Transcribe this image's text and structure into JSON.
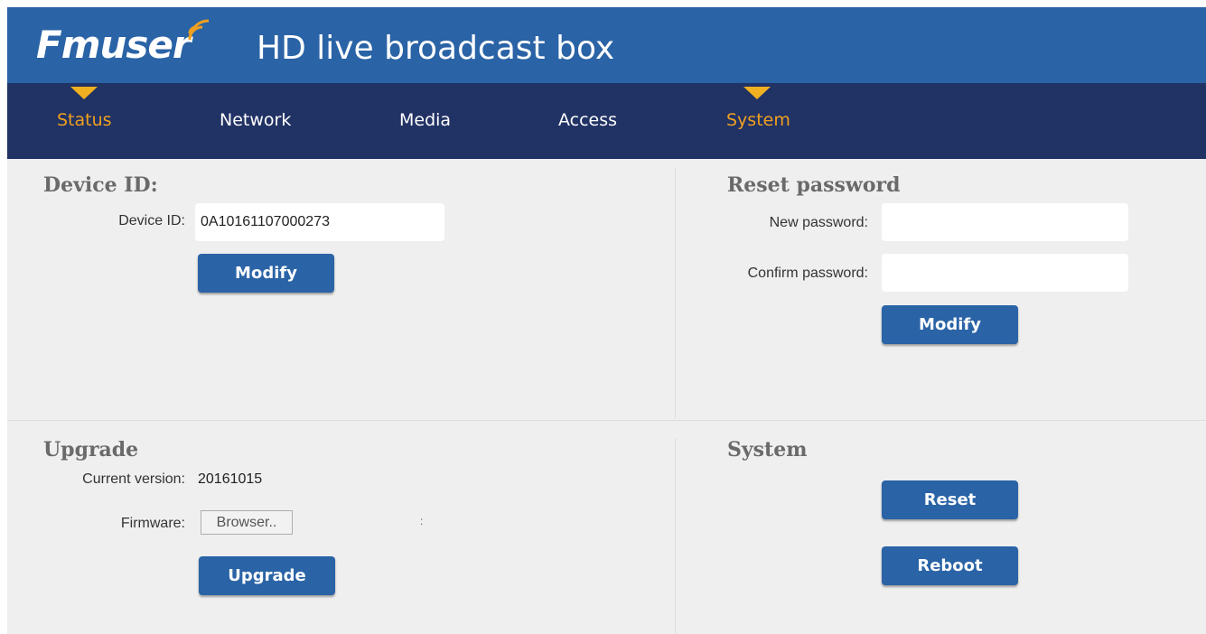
{
  "header": {
    "logo_text": "Fmuser",
    "title": "HD live broadcast box"
  },
  "nav": {
    "items": [
      {
        "label": "Status",
        "active": true
      },
      {
        "label": "Network",
        "active": false
      },
      {
        "label": "Media",
        "active": false
      },
      {
        "label": "Access",
        "active": false
      },
      {
        "label": "System",
        "active": true
      }
    ]
  },
  "device": {
    "title": "Device ID:",
    "label": "Device ID:",
    "value": "0A10161107000273",
    "button": "Modify"
  },
  "reset_password": {
    "title": "Reset password",
    "new_label": "New password:",
    "new_value": "",
    "confirm_label": "Confirm password:",
    "confirm_value": "",
    "button": "Modify"
  },
  "upgrade": {
    "title": "Upgrade",
    "version_label": "Current version:",
    "version_value": "20161015",
    "firmware_label": "Firmware:",
    "browse_label": "Browser..",
    "file_status": ":",
    "button": "Upgrade"
  },
  "system": {
    "title": "System",
    "reset_button": "Reset",
    "reboot_button": "Reboot"
  },
  "colors": {
    "header": "#2a63a6",
    "nav": "#213264",
    "accent": "#f0a020",
    "button": "#2a63a6"
  }
}
